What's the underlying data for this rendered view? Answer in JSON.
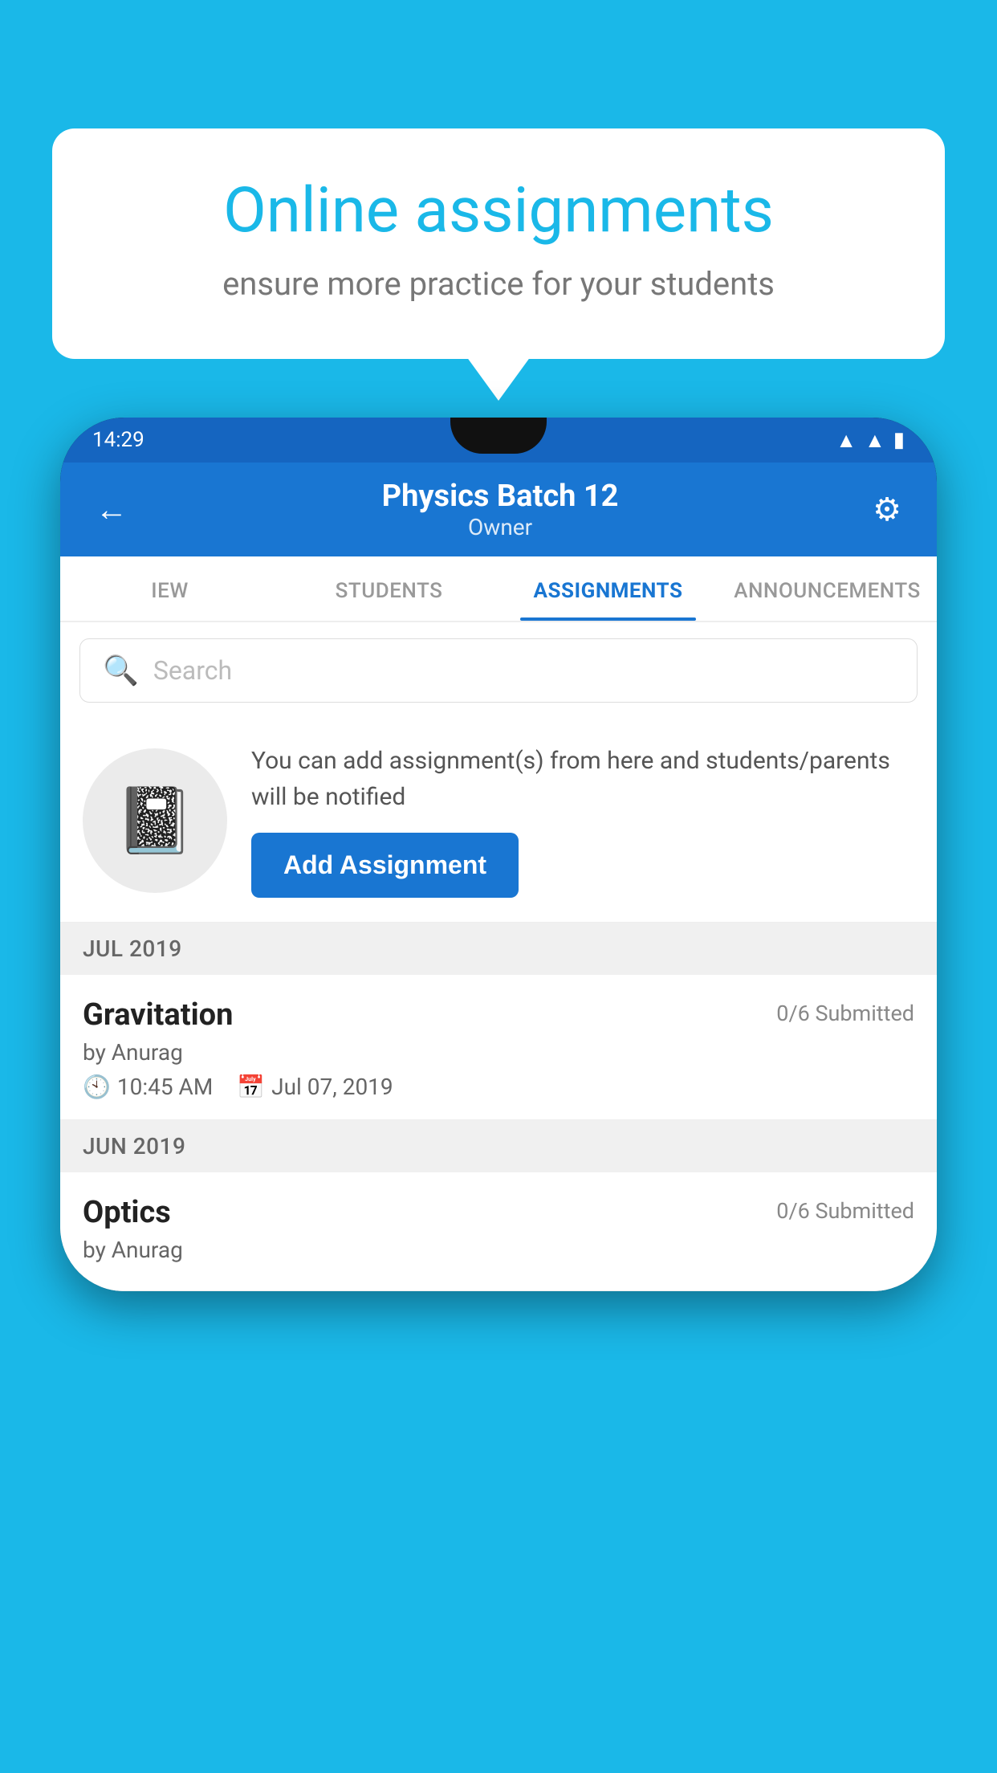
{
  "background": {
    "color": "#1ab8e8"
  },
  "bubble": {
    "title": "Online assignments",
    "subtitle": "ensure more practice for your students"
  },
  "status_bar": {
    "time": "14:29",
    "icons": [
      "wifi",
      "signal",
      "battery"
    ]
  },
  "header": {
    "title": "Physics Batch 12",
    "subtitle": "Owner",
    "back_label": "←",
    "settings_label": "⚙"
  },
  "tabs": [
    {
      "label": "IEW",
      "active": false
    },
    {
      "label": "STUDENTS",
      "active": false
    },
    {
      "label": "ASSIGNMENTS",
      "active": true
    },
    {
      "label": "ANNOUNCEMENTS",
      "active": false
    }
  ],
  "search": {
    "placeholder": "Search"
  },
  "add_assignment": {
    "description": "You can add assignment(s) from here and students/parents will be notified",
    "button_label": "Add Assignment"
  },
  "sections": [
    {
      "month": "JUL 2019",
      "assignments": [
        {
          "name": "Gravitation",
          "submitted": "0/6 Submitted",
          "by": "by Anurag",
          "time": "10:45 AM",
          "date": "Jul 07, 2019"
        }
      ]
    },
    {
      "month": "JUN 2019",
      "assignments": [
        {
          "name": "Optics",
          "submitted": "0/6 Submitted",
          "by": "by Anurag",
          "time": "",
          "date": ""
        }
      ]
    }
  ]
}
